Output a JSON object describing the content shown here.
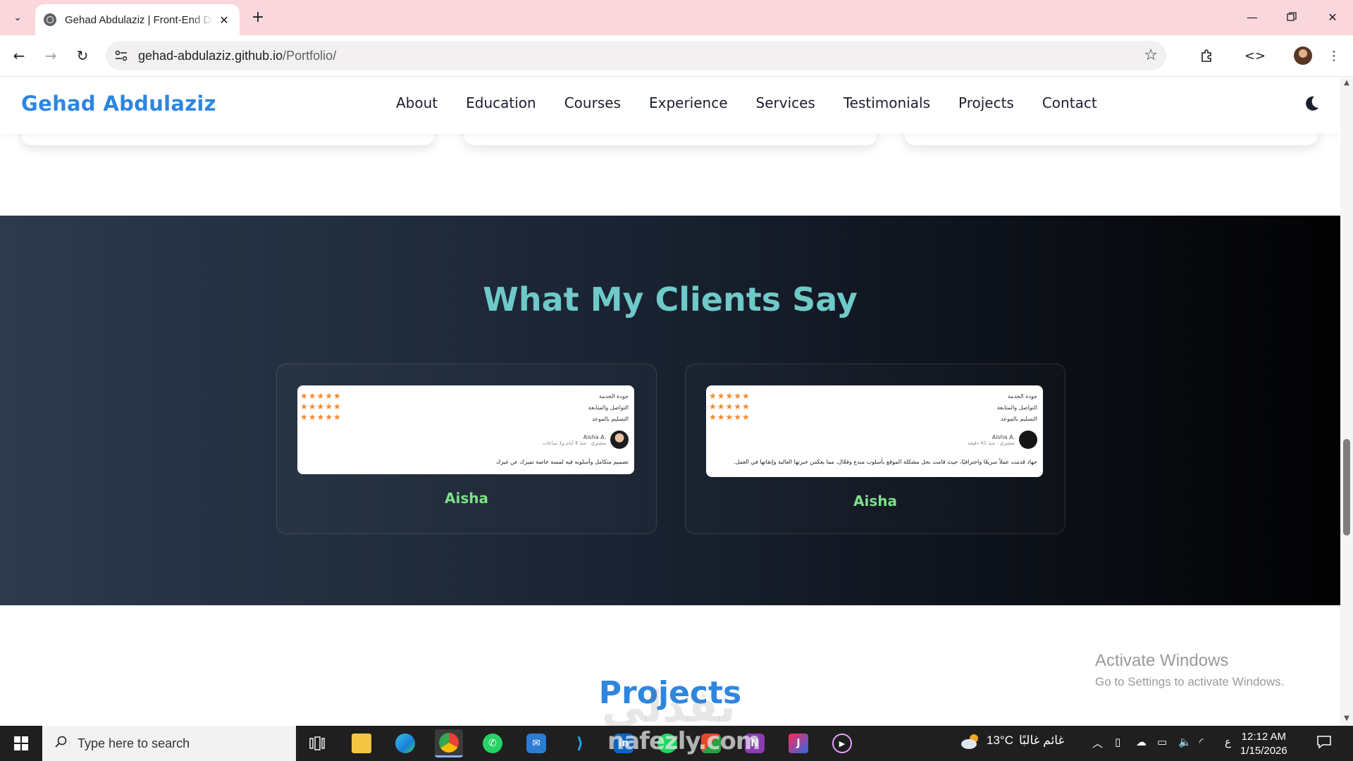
{
  "browser": {
    "tab_title": "Gehad Abdulaziz | Front-End Developer",
    "url_host": "gehad-abdulaziz.github.io",
    "url_path": "/Portfolio/"
  },
  "site": {
    "logo": "Gehad Abdulaziz",
    "nav": [
      "About",
      "Education",
      "Courses",
      "Experience",
      "Services",
      "Testimonials",
      "Projects",
      "Contact"
    ]
  },
  "testimonials": {
    "title": "What My Clients Say",
    "cards": [
      {
        "client": "Aisha",
        "review": {
          "criteria": [
            "جودة الخدمة",
            "التواصل والمتابعة",
            "التسليم بالموعد"
          ],
          "ratings": [
            "★★★★★",
            "★★★★★",
            "★★★★★"
          ],
          "reviewer_name": "Aisha A.",
          "reviewer_meta": "مشتري · منذ 4 أيام و1 ساعات",
          "text": "تصميم متكامل وأسلوبه فيه لمسة خاصة تميزك عن غيرك"
        }
      },
      {
        "client": "Aisha",
        "review": {
          "criteria": [
            "جودة الخدمة",
            "التواصل والمتابعة",
            "التسليم بالموعد"
          ],
          "ratings": [
            "★★★★★",
            "★★★★★",
            "★★★★★"
          ],
          "reviewer_name": "Aisha A.",
          "reviewer_meta": "مشتري · منذ 41 دقيقة",
          "text": "جهاد قدمت عملاً سريعًا واحترافيًا، حيث قامت بحل مشكلة الموقع بأسلوب مبدع وفعّال، مما يعكس خبرتها العالية وإتقانها في العمل."
        }
      }
    ]
  },
  "projects": {
    "title": "Projects"
  },
  "overlay": {
    "watermark": "نفذلي",
    "activate_title": "Activate Windows",
    "activate_sub": "Go to Settings to activate Windows."
  },
  "taskbar": {
    "search_placeholder": "Type here to search",
    "watermark": "nafezly.com",
    "weather_temp": "13°C",
    "weather_desc": "غائم غالبًا",
    "lang": "ع",
    "time": "12:12 AM",
    "date": "1/15/2026"
  },
  "colors": {
    "accent": "#2e86de",
    "section_title": "#6fc9c9",
    "client_name": "#7ee08a",
    "stars": "#f28b30"
  }
}
